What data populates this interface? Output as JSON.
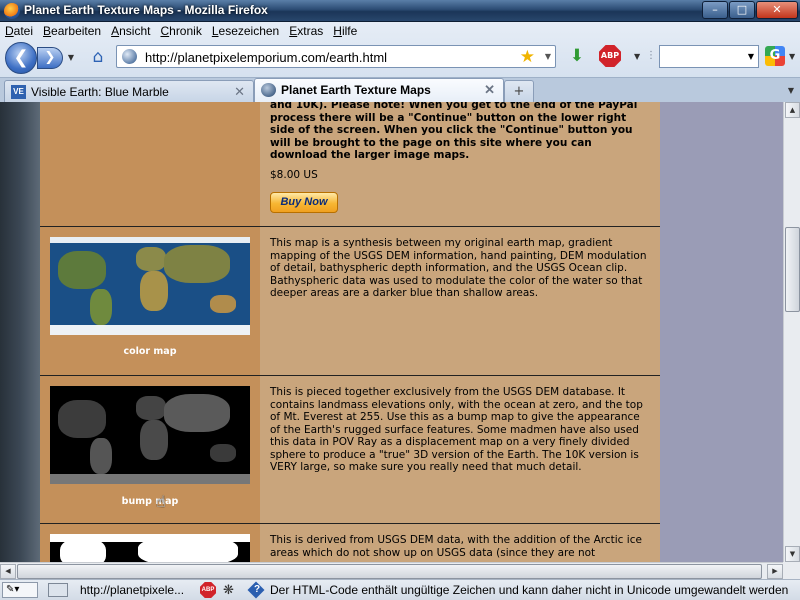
{
  "window": {
    "title": "Planet Earth Texture Maps - Mozilla Firefox",
    "controls": {
      "minimize": "–",
      "maximize": "□",
      "close": "✕"
    }
  },
  "menubar": {
    "items": [
      "Datei",
      "Bearbeiten",
      "Ansicht",
      "Chronik",
      "Lesezeichen",
      "Extras",
      "Hilfe"
    ]
  },
  "navbar": {
    "url": "http://planetpixelemporium.com/earth.html",
    "abp_label": "ABP",
    "google_label": "G"
  },
  "tabs": [
    {
      "title": "Visible Earth: Blue Marble",
      "favicon_text": "VE",
      "active": false
    },
    {
      "title": "Planet Earth Texture Maps",
      "active": true
    }
  ],
  "content": {
    "intro": {
      "partial_text": "and 10K). Please note! When you get to the end of the PayPal process there will be a \"Continue\" button on the lower right side of the screen. When you click the \"Continue\" button you will be brought to the page on this site where you can download the larger image maps.",
      "price": "$8.00 US",
      "buy_button": "Buy Now"
    },
    "maps": [
      {
        "caption": "color map",
        "description": "This map is a synthesis between my original earth map, gradient mapping of the USGS DEM information, hand painting, DEM modulation of detail, bathyspheric depth information, and the USGS Ocean clip. Bathyspheric data was used to modulate the color of the water so that deeper areas are a darker blue than shallow areas."
      },
      {
        "caption": "bump map",
        "description": "This is pieced together exclusively from the USGS DEM database. It contains landmass elevations only, with the ocean at zero, and the top of Mt. Everest at 255. Use this as a bump map to give the appearance of the Earth's rugged surface features. Some madmen have also used this data in POV Ray as a displacement map on a very finely divided sphere to produce a \"true\" 3D version of the Earth. The 10K version is VERY large, so make sure you really need that much detail."
      },
      {
        "caption": "",
        "description": "This is derived from USGS DEM data, with the addition of the Arctic ice areas which do not show up on USGS data (since they are not"
      }
    ]
  },
  "statusbar": {
    "url": "http://planetpixele...",
    "abp_label": "ABP",
    "message": "Der HTML-Code enthält ungültige Zeichen und kann daher nicht in Unicode umgewandelt werden"
  },
  "colors": {
    "content_bg": "#c9a57c",
    "image_column_bg": "#c4905a",
    "right_margin": "#9a9cb6",
    "buy_button": "#f7b733"
  }
}
